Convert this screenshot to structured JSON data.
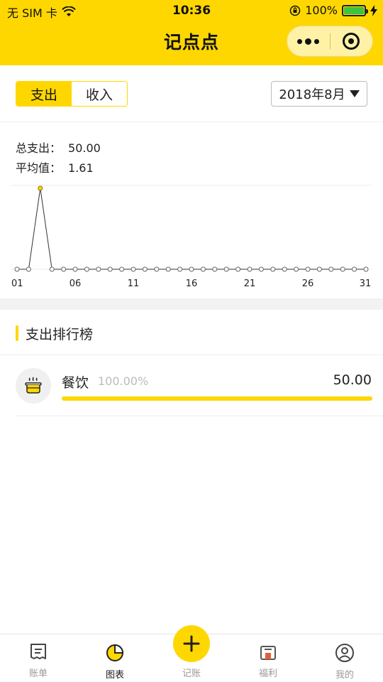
{
  "status_bar": {
    "carrier": "无 SIM 卡",
    "time": "10:36",
    "battery": "100%"
  },
  "nav": {
    "title": "记点点"
  },
  "toggle": {
    "expense": "支出",
    "income": "收入",
    "active": "expense"
  },
  "month_picker": {
    "value": "2018年8月"
  },
  "stats": {
    "total_label": "总支出：",
    "total_value": "50.00",
    "avg_label": "平均值：",
    "avg_value": "1.61"
  },
  "chart_data": {
    "type": "line",
    "x": [
      1,
      2,
      3,
      4,
      5,
      6,
      7,
      8,
      9,
      10,
      11,
      12,
      13,
      14,
      15,
      16,
      17,
      18,
      19,
      20,
      21,
      22,
      23,
      24,
      25,
      26,
      27,
      28,
      29,
      30,
      31
    ],
    "series": [
      {
        "values": [
          0,
          0,
          50,
          0,
          0,
          0,
          0,
          0,
          0,
          0,
          0,
          0,
          0,
          0,
          0,
          0,
          0,
          0,
          0,
          0,
          0,
          0,
          0,
          0,
          0,
          0,
          0,
          0,
          0,
          0,
          0
        ]
      }
    ],
    "tick_labels": [
      "01",
      "06",
      "11",
      "16",
      "21",
      "26",
      "31"
    ],
    "tick_positions": [
      1,
      6,
      11,
      16,
      21,
      26,
      31
    ],
    "ylim": [
      0,
      50
    ],
    "highlight_point": 3,
    "line_color": "#333333",
    "highlight_color": "#FFD700"
  },
  "ranking": {
    "title": "支出排行榜",
    "items": [
      {
        "name": "餐饮",
        "percent": "100.00%",
        "amount": "50.00",
        "fraction": 1.0,
        "icon": "pot-icon"
      }
    ]
  },
  "tabbar": {
    "items": [
      {
        "label": "账单",
        "icon": "receipt-icon"
      },
      {
        "label": "图表",
        "icon": "pie-chart-icon"
      },
      {
        "label": "记账",
        "icon": "plus-icon"
      },
      {
        "label": "福利",
        "icon": "gift-icon"
      },
      {
        "label": "我的",
        "icon": "user-icon"
      }
    ],
    "active_index": 1
  },
  "colors": {
    "accent": "#FFD700",
    "muted": "#999999"
  }
}
